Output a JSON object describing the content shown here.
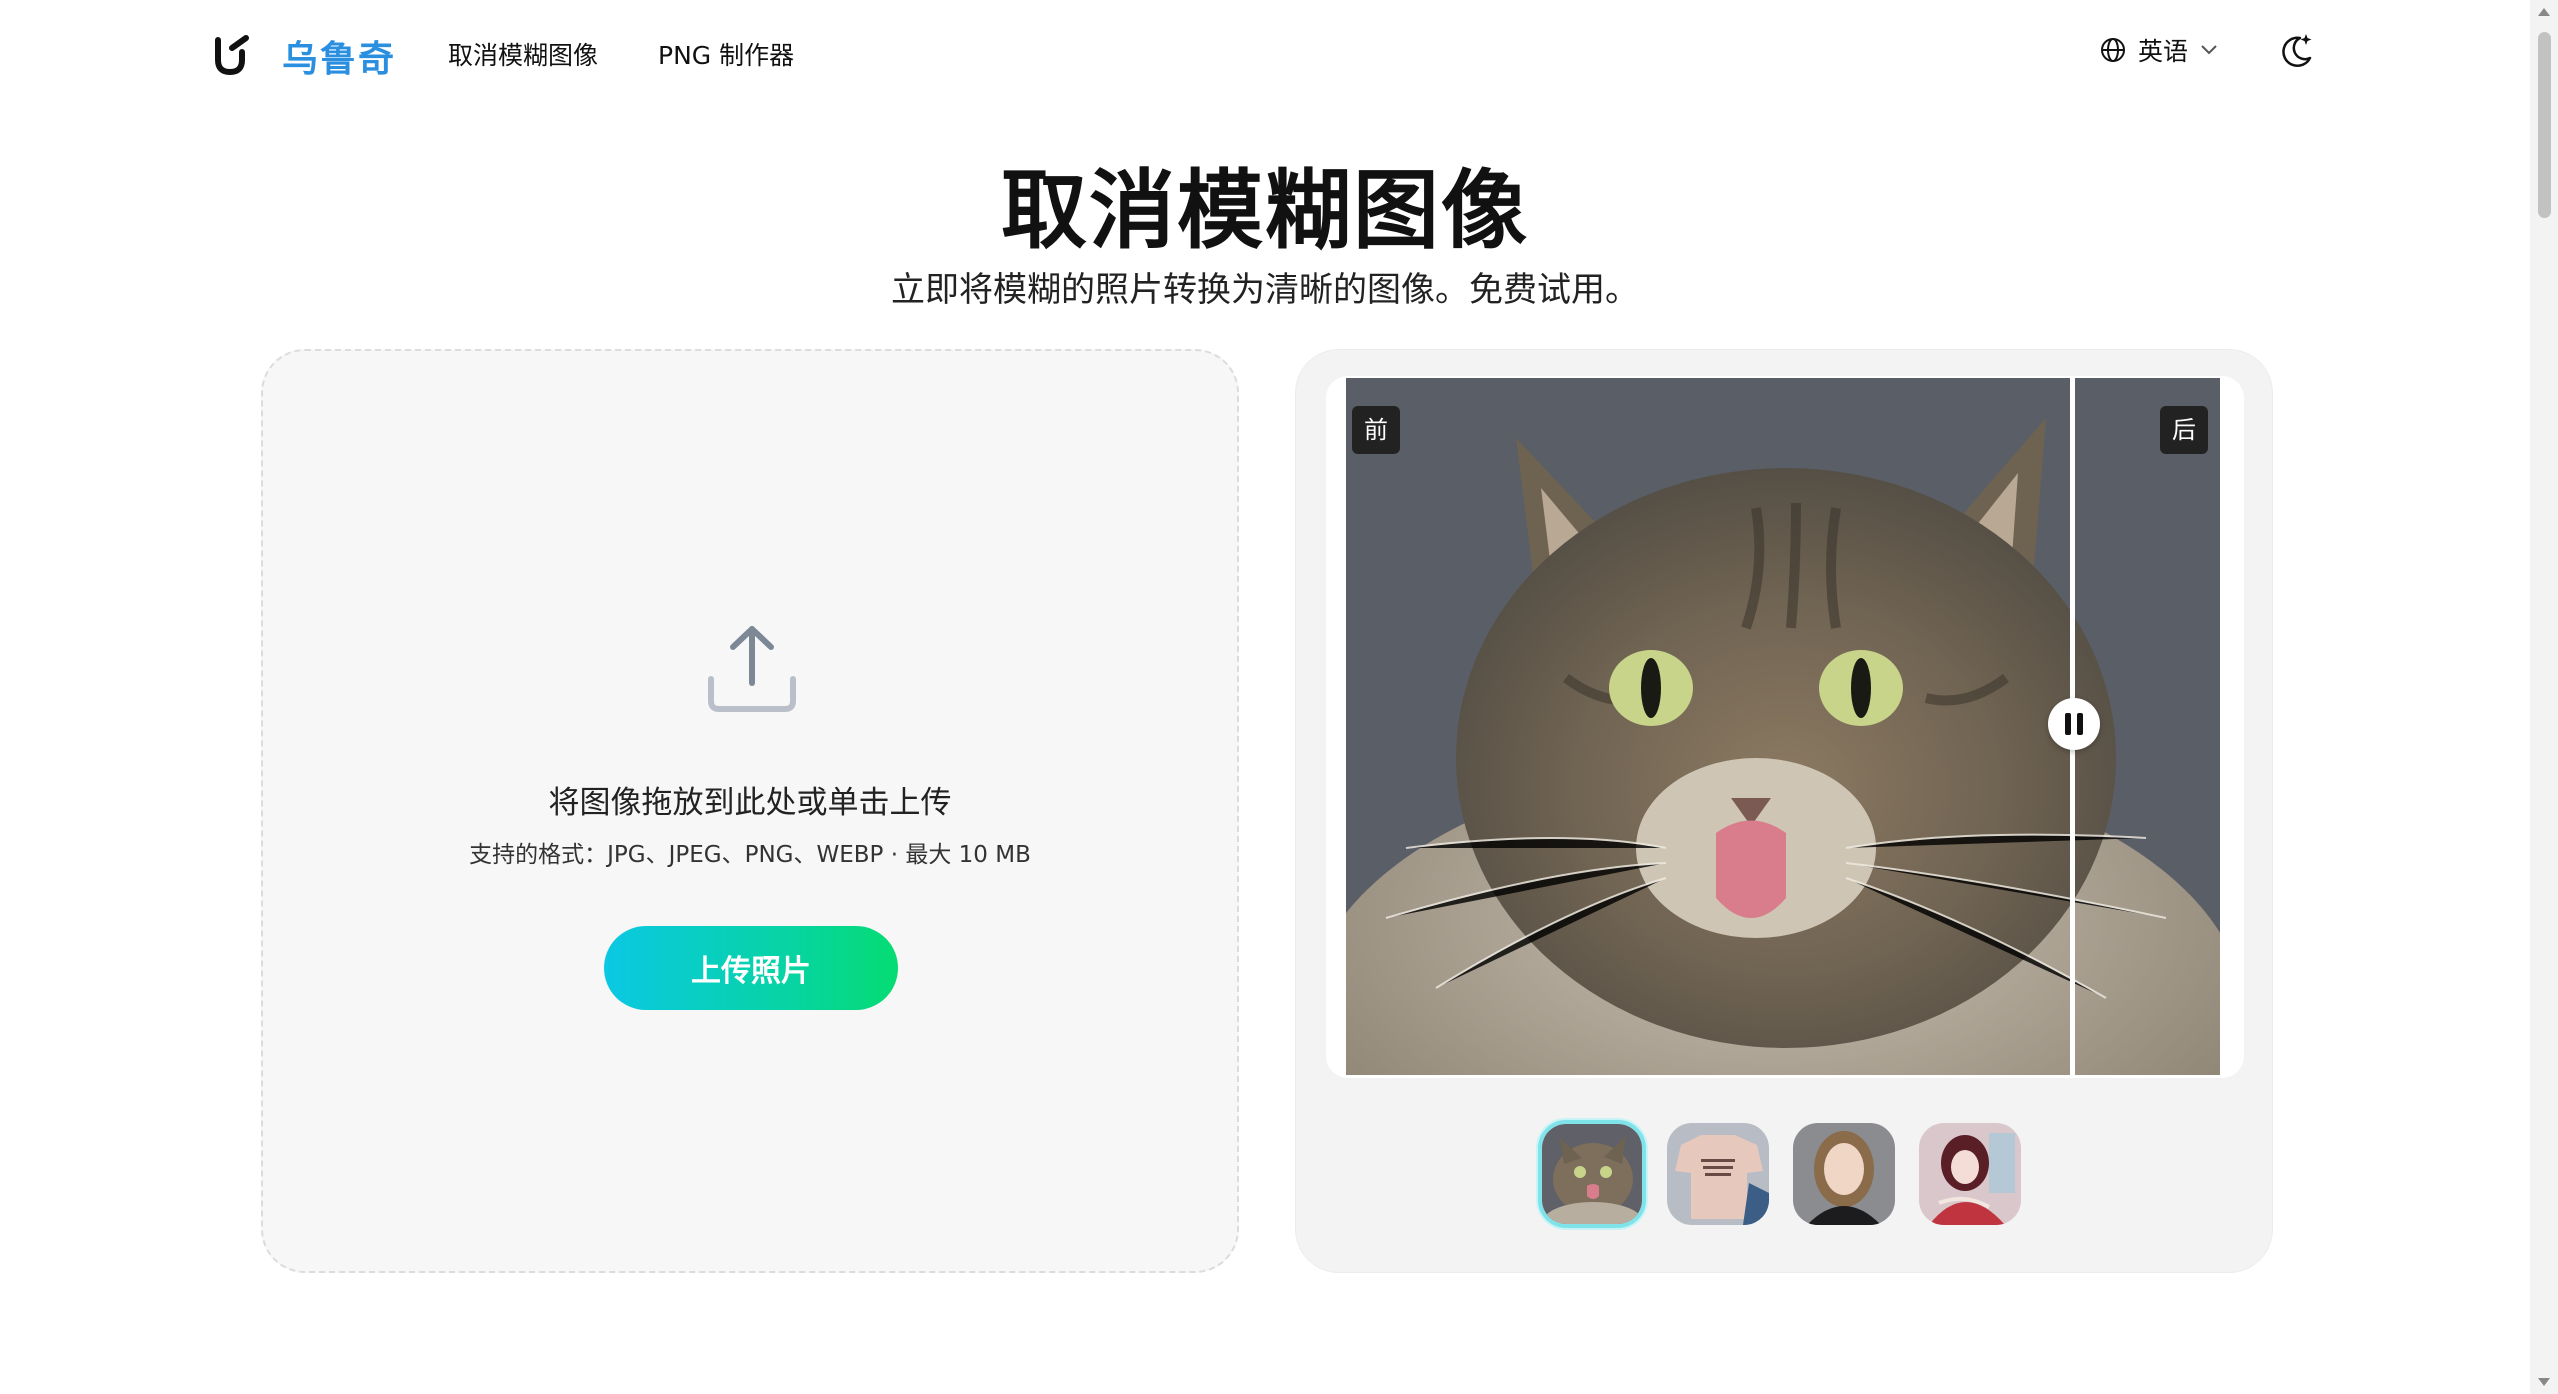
{
  "header": {
    "logo_icon": "logo-mark-icon",
    "brand": "乌鲁奇",
    "nav": [
      {
        "label": "取消模糊图像"
      },
      {
        "label": "PNG 制作器"
      }
    ],
    "language": {
      "icon": "globe-icon",
      "label": "英语",
      "chevron": "chevron-down-icon"
    },
    "theme_icon": "moon-sparkle-icon"
  },
  "hero": {
    "title": "取消模糊图像",
    "subtitle": "立即将模糊的照片转换为清晰的图像。免费试用。"
  },
  "upload": {
    "icon": "upload-icon",
    "title": "将图像拖放到此处或单击上传",
    "formats": "支持的格式：JPG、JPEG、PNG、WEBP · 最大 10 MB",
    "button": "上传照片"
  },
  "demo": {
    "before_label": "前",
    "after_label": "后",
    "divider_position": 0.83,
    "thumbnails": [
      {
        "name": "cat",
        "active": true
      },
      {
        "name": "t-shirt",
        "active": false
      },
      {
        "name": "woman-portrait",
        "active": false
      },
      {
        "name": "anime-girl",
        "active": false
      }
    ]
  },
  "colors": {
    "brand": "#2b8fe0",
    "button_gradient_start": "#0bc8e4",
    "button_gradient_end": "#05dc72",
    "upload_bg": "#f7f7f7",
    "demo_bg": "#f3f3f3"
  }
}
